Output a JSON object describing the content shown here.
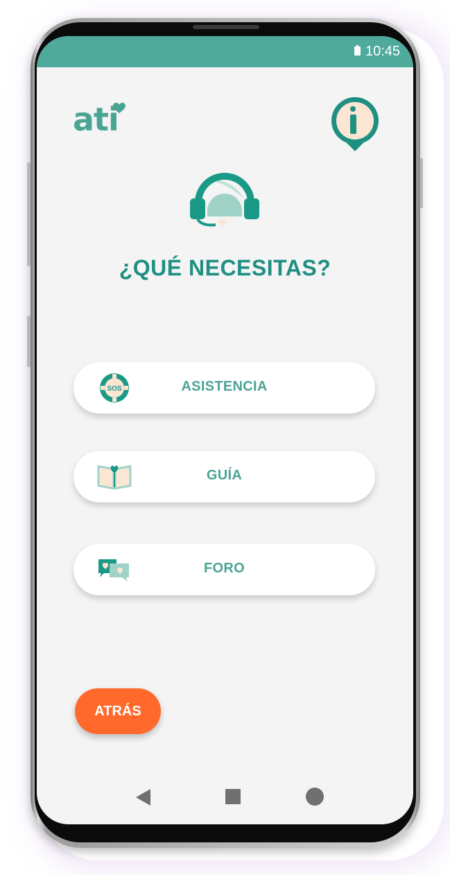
{
  "status_bar": {
    "time": "10:45"
  },
  "header": {
    "logo_text": "ati",
    "info_icon": "info-bubble-icon"
  },
  "main": {
    "hero_icon": "headset-icon",
    "title": "¿QUÉ NECESITAS?",
    "menu": [
      {
        "label": "ASISTENCIA",
        "icon": "sos-lifebuoy-icon"
      },
      {
        "label": "GUÍA",
        "icon": "open-book-heart-icon"
      },
      {
        "label": "FORO",
        "icon": "chat-hearts-icon"
      }
    ],
    "back_label": "ATRÁS"
  },
  "nav_bar": {
    "icons": [
      "back-triangle-icon",
      "home-square-icon",
      "recents-circle-icon"
    ]
  },
  "colors": {
    "primary": "#4faa9b",
    "title": "#1f8f82",
    "accent": "#ff6a2c",
    "background": "#f4f4f5"
  }
}
